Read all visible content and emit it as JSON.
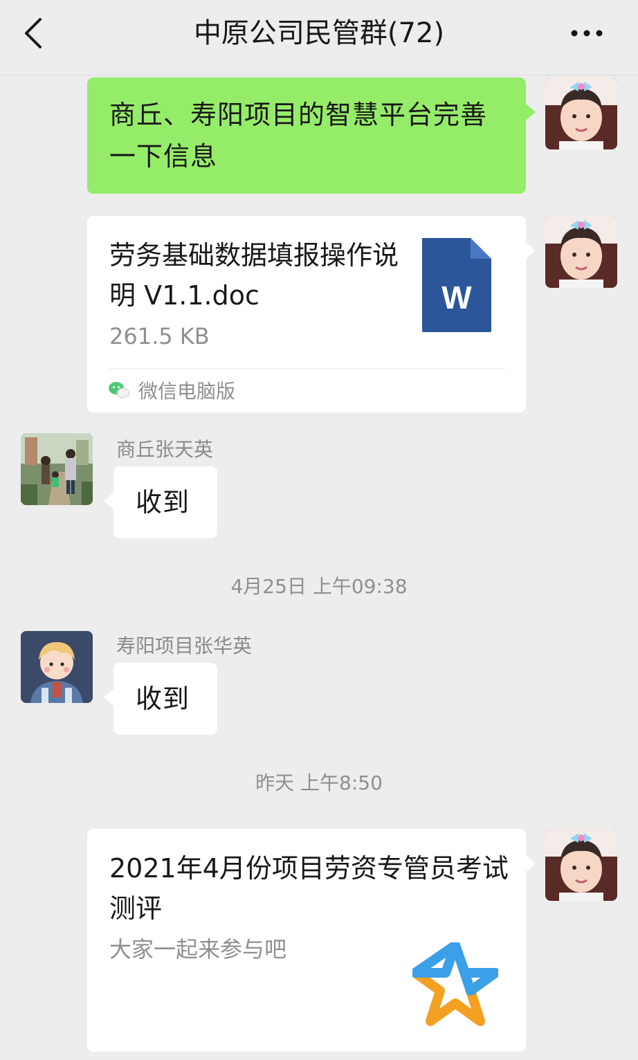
{
  "header": {
    "title": "中原公司民管群(72)",
    "back_icon": "chevron-left-icon",
    "more_icon": "more-dots-icon"
  },
  "messages": {
    "m1": {
      "text": "商丘、寿阳项目的智慧平台完善一下信息"
    },
    "m2": {
      "file_name": "劳务基础数据填报操作说明 V1.1.doc",
      "file_size": "261.5 KB",
      "file_icon_letter": "W",
      "source": "微信电脑版",
      "source_icon": "wechat-icon"
    },
    "m3": {
      "sender": "商丘张天英",
      "text": "收到"
    },
    "time1": "4月25日 上午09:38",
    "m4": {
      "sender": "寿阳项目张华英",
      "text": "收到"
    },
    "time2": "昨天 上午8:50",
    "m5": {
      "title": "2021年4月份项目劳资专管员考试测评",
      "description": "大家一起来参与吧",
      "icon": "star-icon"
    }
  },
  "colors": {
    "background": "#ededed",
    "bubble_self": "#95ec69",
    "bubble_other": "#ffffff",
    "word_blue": "#2b579a"
  }
}
